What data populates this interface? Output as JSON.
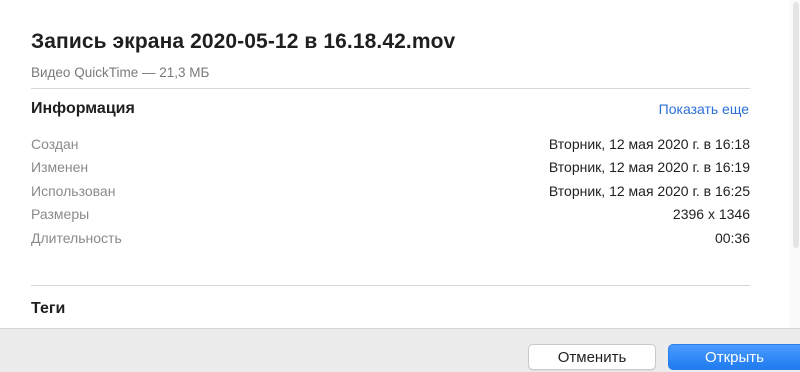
{
  "file": {
    "title": "Запись экрана 2020-05-12 в 16.18.42.mov",
    "subtitle": "Видео QuickTime — 21,3 МБ"
  },
  "info": {
    "heading": "Информация",
    "show_more": "Показать еще",
    "rows": [
      {
        "label": "Создан",
        "value": "Вторник, 12 мая 2020 г. в 16:18"
      },
      {
        "label": "Изменен",
        "value": "Вторник, 12 мая 2020 г. в 16:19"
      },
      {
        "label": "Использован",
        "value": "Вторник, 12 мая 2020 г. в 16:25"
      },
      {
        "label": "Размеры",
        "value": "2396 x 1346"
      },
      {
        "label": "Длительность",
        "value": "00:36"
      }
    ]
  },
  "tags": {
    "heading": "Теги"
  },
  "footer": {
    "cancel_label": "Отменить",
    "open_label": "Открыть"
  },
  "colors": {
    "link": "#2b6fd6",
    "primary_button": "#1f7bf0",
    "footer_background": "#ececec"
  }
}
